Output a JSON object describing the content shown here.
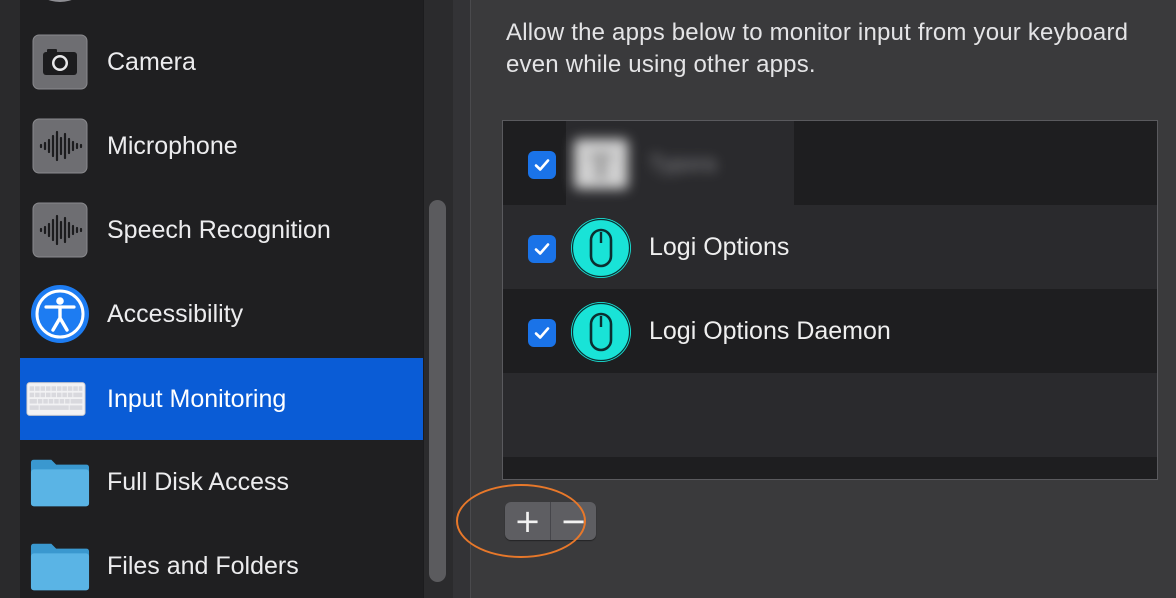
{
  "sidebar": {
    "items": [
      {
        "label": "Camera",
        "icon": "camera-icon"
      },
      {
        "label": "Microphone",
        "icon": "microphone-icon"
      },
      {
        "label": "Speech Recognition",
        "icon": "speech-recognition-icon"
      },
      {
        "label": "Accessibility",
        "icon": "accessibility-icon"
      },
      {
        "label": "Input Monitoring",
        "icon": "keyboard-icon",
        "selected": true
      },
      {
        "label": "Full Disk Access",
        "icon": "folder-icon"
      },
      {
        "label": "Files and Folders",
        "icon": "folder-icon"
      }
    ]
  },
  "main": {
    "description": "Allow the apps below to monitor input from your keyboard even while using other apps.",
    "apps": [
      {
        "name": "Typora",
        "checked": true,
        "blurred": true
      },
      {
        "name": "Logi Options",
        "checked": true
      },
      {
        "name": "Logi Options Daemon",
        "checked": true
      }
    ],
    "add_label": "+",
    "remove_label": "−"
  },
  "colors": {
    "selection": "#0a5cd6",
    "checkbox": "#1a73e8",
    "logi_icon": "#19e3d7",
    "highlight": "#e8782a"
  }
}
